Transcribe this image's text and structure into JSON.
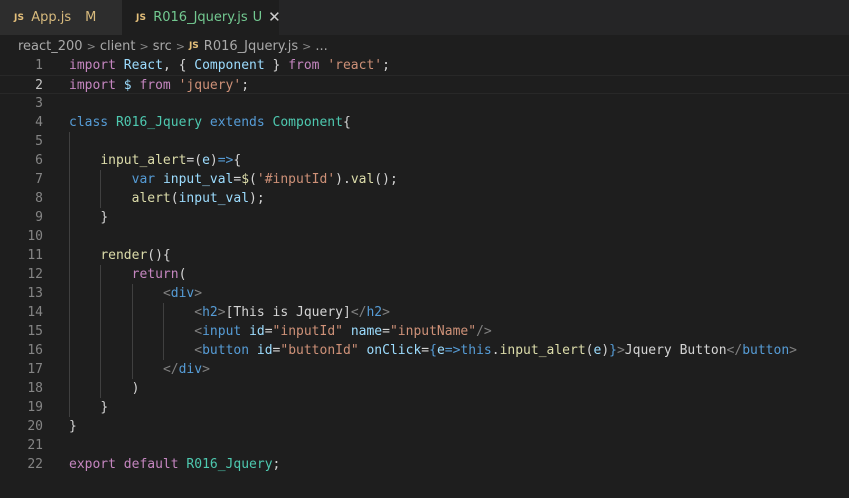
{
  "tabs": [
    {
      "icon": "JS",
      "name": "App.js",
      "status": "M",
      "active": false
    },
    {
      "icon": "JS",
      "name": "R016_Jquery.js",
      "status": "U",
      "active": true,
      "close": "✕"
    }
  ],
  "breadcrumb": {
    "segments": [
      "react_200",
      "client",
      "src"
    ],
    "file_icon": "JS",
    "file": "R016_Jquery.js",
    "more": "..."
  },
  "editor": {
    "current_line": 2,
    "lines": [
      {
        "n": "1",
        "indent": 0,
        "tokens": [
          [
            "kw2",
            "import"
          ],
          [
            "pun",
            " "
          ],
          [
            "id",
            "React"
          ],
          [
            "pun",
            ", { "
          ],
          [
            "id",
            "Component"
          ],
          [
            "pun",
            " } "
          ],
          [
            "kw2",
            "from"
          ],
          [
            "pun",
            " "
          ],
          [
            "str",
            "'react'"
          ],
          [
            "pun",
            ";"
          ]
        ]
      },
      {
        "n": "2",
        "indent": 0,
        "tokens": [
          [
            "kw2",
            "import"
          ],
          [
            "pun",
            " "
          ],
          [
            "id",
            "$"
          ],
          [
            "pun",
            " "
          ],
          [
            "kw2",
            "from"
          ],
          [
            "pun",
            " "
          ],
          [
            "str",
            "'jquery'"
          ],
          [
            "pun",
            ";"
          ]
        ]
      },
      {
        "n": "3",
        "indent": 0,
        "tokens": []
      },
      {
        "n": "4",
        "indent": 0,
        "tokens": [
          [
            "kw",
            "class"
          ],
          [
            "pun",
            " "
          ],
          [
            "cls",
            "R016_Jquery"
          ],
          [
            "pun",
            " "
          ],
          [
            "kw",
            "extends"
          ],
          [
            "pun",
            " "
          ],
          [
            "cls",
            "Component"
          ],
          [
            "pun",
            "{"
          ]
        ]
      },
      {
        "n": "5",
        "indent": 0,
        "tokens": []
      },
      {
        "n": "6",
        "indent": 1,
        "tokens": [
          [
            "fn",
            "input_alert"
          ],
          [
            "pun",
            "=("
          ],
          [
            "id",
            "e"
          ],
          [
            "pun",
            ")"
          ],
          [
            "kw",
            "=>"
          ],
          [
            "pun",
            "{"
          ]
        ]
      },
      {
        "n": "7",
        "indent": 2,
        "tokens": [
          [
            "kw",
            "var"
          ],
          [
            "pun",
            " "
          ],
          [
            "id",
            "input_val"
          ],
          [
            "pun",
            "="
          ],
          [
            "fn",
            "$"
          ],
          [
            "pun",
            "("
          ],
          [
            "str",
            "'#inputId'"
          ],
          [
            "pun",
            ")."
          ],
          [
            "fn",
            "val"
          ],
          [
            "pun",
            "();"
          ]
        ]
      },
      {
        "n": "8",
        "indent": 2,
        "tokens": [
          [
            "fn",
            "alert"
          ],
          [
            "pun",
            "("
          ],
          [
            "id",
            "input_val"
          ],
          [
            "pun",
            ");"
          ]
        ]
      },
      {
        "n": "9",
        "indent": 1,
        "tokens": [
          [
            "pun",
            "}"
          ]
        ]
      },
      {
        "n": "10",
        "indent": 0,
        "tokens": []
      },
      {
        "n": "11",
        "indent": 1,
        "tokens": [
          [
            "fn",
            "render"
          ],
          [
            "pun",
            "(){"
          ]
        ]
      },
      {
        "n": "12",
        "indent": 2,
        "tokens": [
          [
            "kw2",
            "return"
          ],
          [
            "pun",
            "("
          ]
        ]
      },
      {
        "n": "13",
        "indent": 3,
        "tokens": [
          [
            "tagp",
            "<"
          ],
          [
            "tag",
            "div"
          ],
          [
            "tagp",
            ">"
          ]
        ]
      },
      {
        "n": "14",
        "indent": 4,
        "tokens": [
          [
            "tagp",
            "<"
          ],
          [
            "tag",
            "h2"
          ],
          [
            "tagp",
            ">"
          ],
          [
            "txt",
            "[This is Jquery]"
          ],
          [
            "tagp",
            "</"
          ],
          [
            "tag",
            "h2"
          ],
          [
            "tagp",
            ">"
          ]
        ]
      },
      {
        "n": "15",
        "indent": 4,
        "tokens": [
          [
            "tagp",
            "<"
          ],
          [
            "tag",
            "input"
          ],
          [
            "pun",
            " "
          ],
          [
            "attr",
            "id"
          ],
          [
            "pun",
            "="
          ],
          [
            "str",
            "\"inputId\""
          ],
          [
            "pun",
            " "
          ],
          [
            "attr",
            "name"
          ],
          [
            "pun",
            "="
          ],
          [
            "str",
            "\"inputName\""
          ],
          [
            "tagp",
            "/>"
          ]
        ]
      },
      {
        "n": "16",
        "indent": 4,
        "tokens": [
          [
            "tagp",
            "<"
          ],
          [
            "tag",
            "button"
          ],
          [
            "pun",
            " "
          ],
          [
            "attr",
            "id"
          ],
          [
            "pun",
            "="
          ],
          [
            "str",
            "\"buttonId\""
          ],
          [
            "pun",
            " "
          ],
          [
            "attr",
            "onClick"
          ],
          [
            "pun",
            "="
          ],
          [
            "kw",
            "{"
          ],
          [
            "id",
            "e"
          ],
          [
            "kw",
            "=>"
          ],
          [
            "kw",
            "this"
          ],
          [
            "pun",
            "."
          ],
          [
            "fn",
            "input_alert"
          ],
          [
            "pun",
            "("
          ],
          [
            "id",
            "e"
          ],
          [
            "pun",
            ")"
          ],
          [
            "kw",
            "}"
          ],
          [
            "tagp",
            ">"
          ],
          [
            "txt",
            "Jquery Button"
          ],
          [
            "tagp",
            "</"
          ],
          [
            "tag",
            "button"
          ],
          [
            "tagp",
            ">"
          ]
        ]
      },
      {
        "n": "17",
        "indent": 3,
        "tokens": [
          [
            "tagp",
            "</"
          ],
          [
            "tag",
            "div"
          ],
          [
            "tagp",
            ">"
          ]
        ]
      },
      {
        "n": "18",
        "indent": 2,
        "tokens": [
          [
            "pun",
            ")"
          ]
        ]
      },
      {
        "n": "19",
        "indent": 1,
        "tokens": [
          [
            "pun",
            "}"
          ]
        ]
      },
      {
        "n": "20",
        "indent": 0,
        "tokens": [
          [
            "pun",
            "}"
          ]
        ]
      },
      {
        "n": "21",
        "indent": 0,
        "tokens": []
      },
      {
        "n": "22",
        "indent": 0,
        "tokens": [
          [
            "kw2",
            "export"
          ],
          [
            "pun",
            " "
          ],
          [
            "kw2",
            "default"
          ],
          [
            "pun",
            " "
          ],
          [
            "cls",
            "R016_Jquery"
          ],
          [
            "pun",
            ";"
          ]
        ]
      }
    ]
  },
  "guides": [
    [],
    [],
    [],
    [],
    [
      1
    ],
    [
      1
    ],
    [
      1,
      2
    ],
    [
      1,
      2
    ],
    [
      1
    ],
    [
      1
    ],
    [
      1
    ],
    [
      1,
      2
    ],
    [
      1,
      2,
      3
    ],
    [
      1,
      2,
      3,
      4
    ],
    [
      1,
      2,
      3,
      4
    ],
    [
      1,
      2,
      3,
      4
    ],
    [
      1,
      2,
      3
    ],
    [
      1,
      2
    ],
    [
      1
    ],
    [],
    [],
    []
  ]
}
